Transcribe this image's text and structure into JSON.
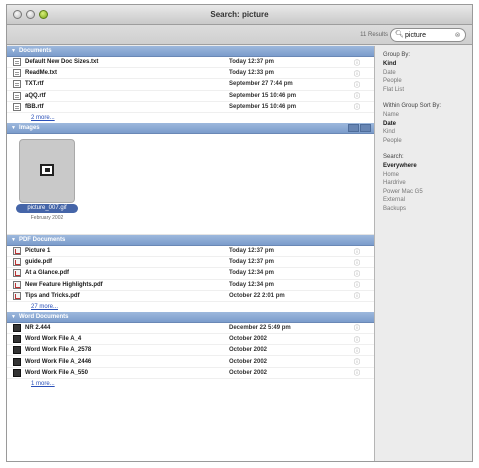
{
  "window": {
    "title": "Search: picture"
  },
  "toolbar": {
    "results_count": "11 Results",
    "search_value": "picture"
  },
  "groups": {
    "documents": {
      "label": "Documents",
      "rows": [
        {
          "name": "Default New Doc Sizes.txt",
          "date": "Today 12:37 pm"
        },
        {
          "name": "ReadMe.txt",
          "date": "Today 12:33 pm"
        },
        {
          "name": "TXT.rtf",
          "date": "September 27 7:44 pm"
        },
        {
          "name": "aQQ.rtf",
          "date": "September 15 10:46 pm"
        },
        {
          "name": "fBB.rtf",
          "date": "September 15 10:46 pm"
        }
      ],
      "more": "2 more..."
    },
    "images": {
      "label": "Images",
      "thumb_name": "picture_007.gif",
      "thumb_date": "February 2002"
    },
    "pdf": {
      "label": "PDF Documents",
      "rows": [
        {
          "name": "Picture 1",
          "date": "Today 12:37 pm"
        },
        {
          "name": "guide.pdf",
          "date": "Today 12:37 pm"
        },
        {
          "name": "At a Glance.pdf",
          "date": "Today 12:34 pm"
        },
        {
          "name": "New Feature Highlights.pdf",
          "date": "Today 12:34 pm"
        },
        {
          "name": "Tips and Tricks.pdf",
          "date": "October 22 2:01 pm"
        }
      ],
      "more": "27 more..."
    },
    "word": {
      "label": "Word Documents",
      "rows": [
        {
          "name": "NR 2.444",
          "date": "December 22 5:49 pm"
        },
        {
          "name": "Word Work File A_4",
          "date": "October 2002"
        },
        {
          "name": "Word Work File A_2578",
          "date": "October 2002"
        },
        {
          "name": "Word Work File A_2446",
          "date": "October 2002"
        },
        {
          "name": "Word Work File A_550",
          "date": "October 2002"
        }
      ],
      "more": "1 more..."
    }
  },
  "sidebar": {
    "group_by": {
      "heading": "Group By:",
      "items": [
        {
          "label": "Kind",
          "selected": true
        },
        {
          "label": "Date",
          "selected": false
        },
        {
          "label": "People",
          "selected": false
        },
        {
          "label": "Flat List",
          "selected": false
        }
      ]
    },
    "sort_by": {
      "heading": "Within Group Sort By:",
      "items": [
        {
          "label": "Name",
          "selected": false
        },
        {
          "label": "Date",
          "selected": true
        },
        {
          "label": "Kind",
          "selected": false
        },
        {
          "label": "People",
          "selected": false
        }
      ]
    },
    "search": {
      "heading": "Search:",
      "items": [
        {
          "label": "Everywhere",
          "selected": true
        },
        {
          "label": "Home",
          "selected": false
        },
        {
          "label": "Hardrive",
          "selected": false
        },
        {
          "label": "Power Mac G5",
          "selected": false
        },
        {
          "label": "External",
          "selected": false
        },
        {
          "label": "Backups",
          "selected": false
        }
      ]
    }
  }
}
